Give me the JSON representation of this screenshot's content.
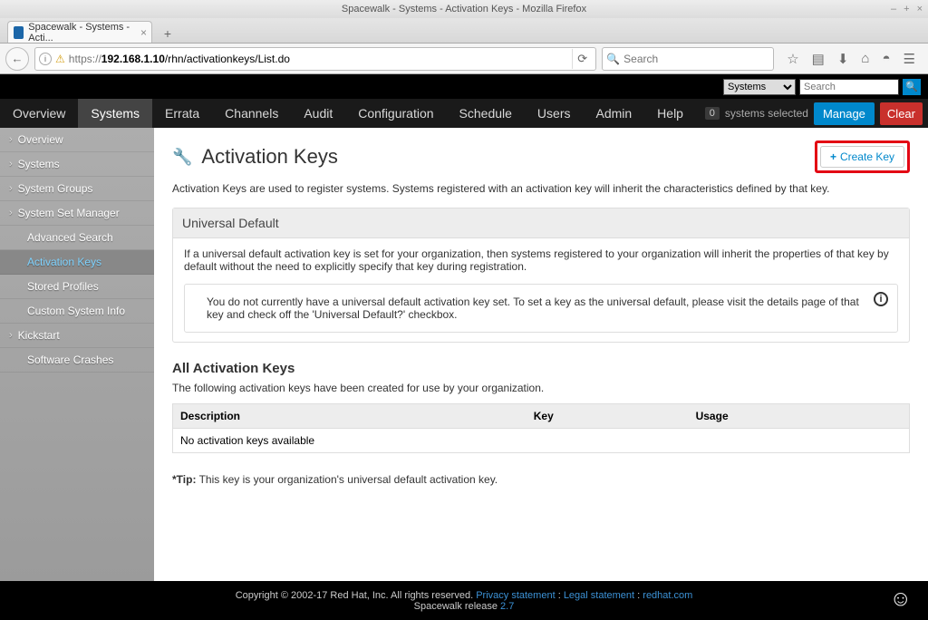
{
  "window": {
    "title": "Spacewalk - Systems - Activation Keys - Mozilla Firefox"
  },
  "tab": {
    "title": "Spacewalk - Systems - Acti..."
  },
  "url": {
    "host": "192.168.1.10",
    "path": "/rhn/activationkeys/List.do"
  },
  "browser_search": {
    "placeholder": "Search"
  },
  "header": {
    "dropdown": "Systems",
    "search_placeholder": "Search"
  },
  "nav": {
    "items": [
      "Overview",
      "Systems",
      "Errata",
      "Channels",
      "Audit",
      "Configuration",
      "Schedule",
      "Users",
      "Admin",
      "Help"
    ],
    "active": "Systems",
    "systems_selected_count": "0",
    "systems_selected_label": "systems selected",
    "manage": "Manage",
    "clear": "Clear"
  },
  "sidebar": {
    "items": [
      "Overview",
      "Systems",
      "System Groups",
      "System Set Manager",
      "Advanced Search",
      "Activation Keys",
      "Stored Profiles",
      "Custom System Info",
      "Kickstart",
      "Software Crashes"
    ],
    "active_index": 5
  },
  "page": {
    "title": "Activation Keys",
    "create_btn": "Create Key",
    "intro": "Activation Keys are used to register systems. Systems registered with an activation key will inherit the characteristics defined by that key."
  },
  "universal": {
    "heading": "Universal Default",
    "body": "If a universal default activation key is set for your organization, then systems registered to your organization will inherit the properties of that key by default without the need to explicitly specify that key during registration.",
    "info": "You do not currently have a universal default activation key set. To set a key as the universal default, please visit the details page of that key and check off the 'Universal Default?' checkbox."
  },
  "all_keys": {
    "heading": "All Activation Keys",
    "desc": "The following activation keys have been created for use by your organization.",
    "cols": [
      "Description",
      "Key",
      "Usage"
    ],
    "empty": "No activation keys available"
  },
  "tip": {
    "label": "*Tip:",
    "text": " This key is your organization's universal default activation key."
  },
  "footer": {
    "copyright": "Copyright © 2002-17 Red Hat, Inc. All rights reserved. ",
    "privacy": "Privacy statement",
    "legal": "Legal statement",
    "redhat": "redhat.com",
    "release_label": "Spacewalk release ",
    "release_ver": "2.7"
  }
}
